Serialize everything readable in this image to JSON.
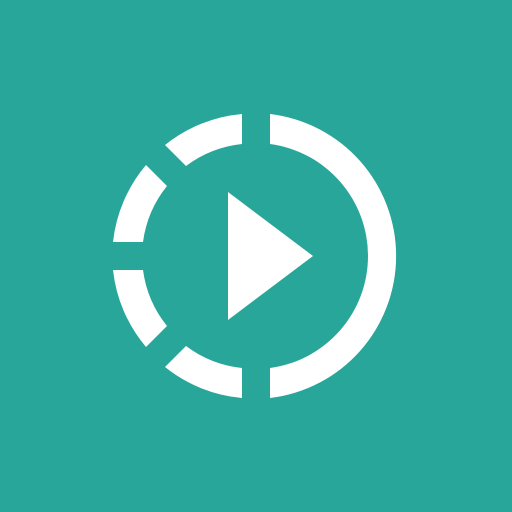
{
  "icon": {
    "name": "play-progress-icon",
    "background_color": "#29A69A",
    "foreground_color": "#FFFFFF"
  }
}
